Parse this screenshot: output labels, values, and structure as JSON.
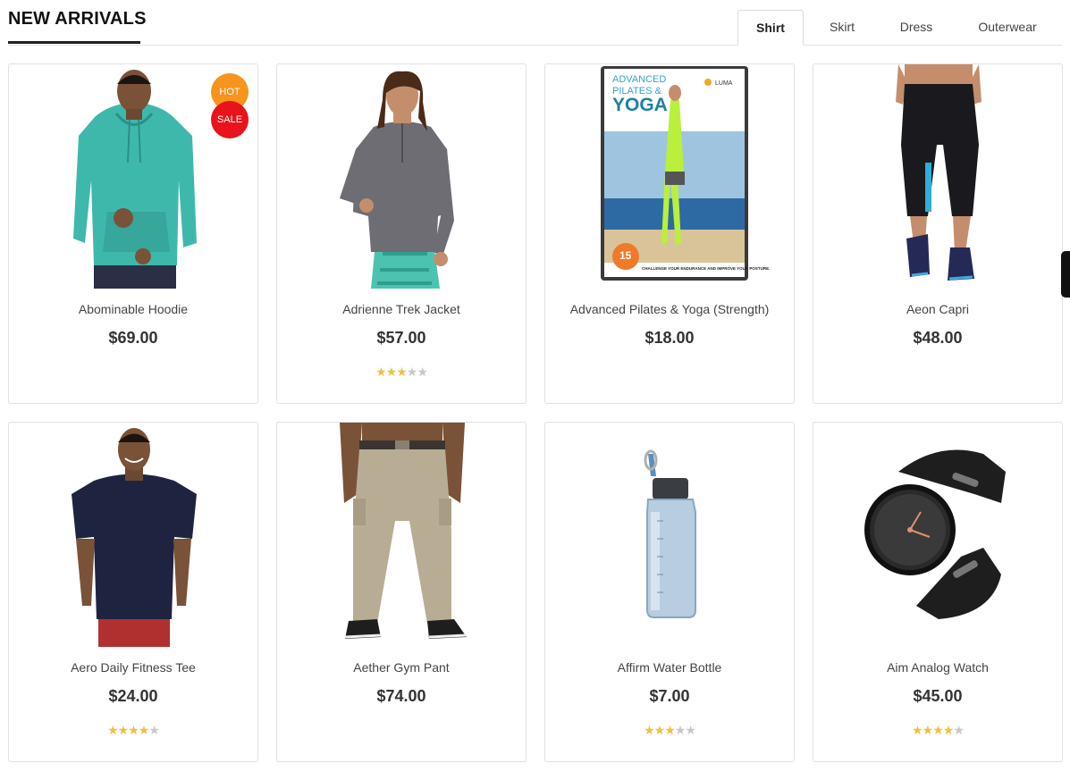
{
  "section": {
    "title": "NEW ARRIVALS",
    "tabs": [
      {
        "label": "Shirt",
        "active": true
      },
      {
        "label": "Skirt",
        "active": false
      },
      {
        "label": "Dress",
        "active": false
      },
      {
        "label": "Outerwear",
        "active": false
      }
    ]
  },
  "products": [
    {
      "name": "Abominable Hoodie",
      "price": "$69.00",
      "rating": 0,
      "badges": [
        "HOT",
        "SALE"
      ]
    },
    {
      "name": "Adrienne Trek Jacket",
      "price": "$57.00",
      "rating": 3
    },
    {
      "name": "Advanced Pilates & Yoga (Strength)",
      "price": "$18.00",
      "rating": 0,
      "dvd": {
        "title_line1": "ADVANCED",
        "title_line2": "PILATES &",
        "title_line3": "YOGA",
        "brand": "LUMA",
        "number": "15",
        "bottom_text": "CHALLENGE YOUR ENDURANCE AND IMPROVE YOUR POSTURE."
      }
    },
    {
      "name": "Aeon Capri",
      "price": "$48.00",
      "rating": 0
    },
    {
      "name": "Aero Daily Fitness Tee",
      "price": "$24.00",
      "rating": 4
    },
    {
      "name": "Aether Gym Pant",
      "price": "$74.00",
      "rating": 0
    },
    {
      "name": "Affirm Water Bottle",
      "price": "$7.00",
      "rating": 3
    },
    {
      "name": "Aim Analog Watch",
      "price": "$45.00",
      "rating": 4
    }
  ],
  "colors": {
    "hot_badge": "#f7941d",
    "sale_badge": "#e8141b",
    "star": "#f0c040"
  }
}
